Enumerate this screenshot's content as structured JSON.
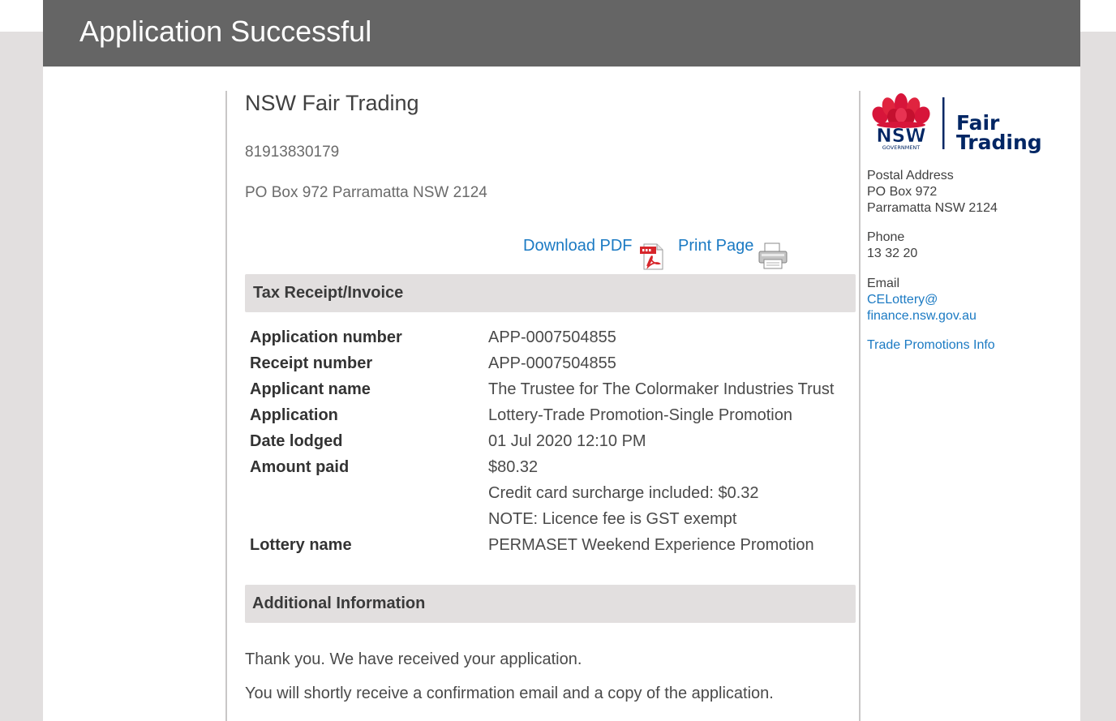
{
  "header": {
    "title": "Application Successful"
  },
  "organisation": {
    "name": "NSW Fair Trading",
    "abn": "81913830179",
    "address": "PO Box 972 Parramatta NSW 2124"
  },
  "actions": {
    "download_pdf": "Download PDF",
    "print_page": "Print Page"
  },
  "receipt": {
    "section_title": "Tax Receipt/Invoice",
    "application_number_label": "Application number",
    "application_number": "APP-0007504855",
    "receipt_number_label": "Receipt number",
    "receipt_number": "APP-0007504855",
    "applicant_name_label": "Applicant name",
    "applicant_name": "The Trustee for The Colormaker Industries Trust",
    "application_label": "Application",
    "application": "Lottery-Trade Promotion-Single Promotion",
    "date_lodged_label": "Date lodged",
    "date_lodged": "01 Jul 2020 12:10 PM",
    "amount_paid_label": "Amount paid",
    "amount_paid": "$80.32",
    "surcharge_note": "Credit card surcharge included: $0.32",
    "gst_note": "NOTE: Licence fee is GST exempt",
    "lottery_name_label": "Lottery name",
    "lottery_name": "PERMASET Weekend Experience Promotion"
  },
  "additional": {
    "section_title": "Additional Information",
    "message_1": "Thank you. We have received your application.",
    "message_2": "You will shortly receive a confirmation email and a copy of the application."
  },
  "sidebar": {
    "logo_text_nsw": "NSW",
    "logo_text_government": "GOVERNMENT",
    "logo_text_fair": "Fair",
    "logo_text_trading": "Trading",
    "postal_label": "Postal Address",
    "postal_line1": "PO Box 972",
    "postal_line2": "Parramatta NSW 2124",
    "phone_label": "Phone",
    "phone": "13 32 20",
    "email_label": "Email",
    "email_line1": "CELottery@",
    "email_line2": "finance.nsw.gov.au",
    "trade_promotions_link": "Trade Promotions Info"
  },
  "colors": {
    "header_bg": "#656565",
    "link": "#1b7ac3",
    "section_bar": "#e2dfdf",
    "logo_red": "#d7153a",
    "logo_navy": "#002664"
  },
  "icons": [
    "pdf-icon",
    "printer-icon",
    "waratah-icon"
  ]
}
